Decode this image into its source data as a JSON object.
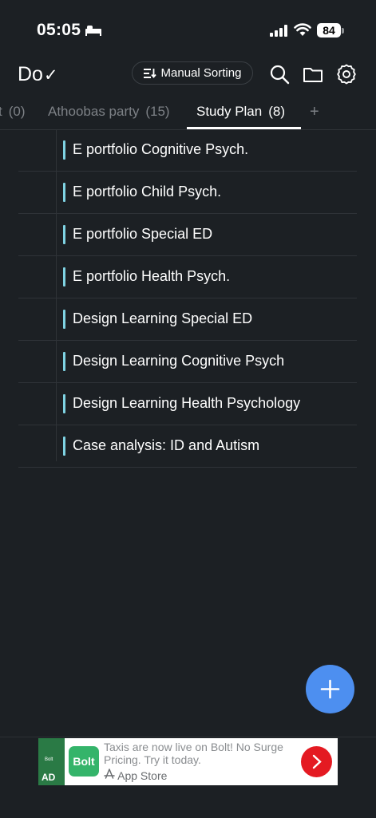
{
  "status_bar": {
    "time": "05:05",
    "battery": "84"
  },
  "header": {
    "title": "Do",
    "check_glyph": "✓",
    "sort_label": "Manual Sorting"
  },
  "tabs": [
    {
      "label": "t",
      "count": "(0)"
    },
    {
      "label": "Athoobas party",
      "count": "(15)"
    },
    {
      "label": "Study Plan",
      "count": "(8)",
      "active": true
    }
  ],
  "tab_add": "+",
  "tasks": [
    "E portfolio Cognitive Psych.",
    "E portfolio Child Psych.",
    "E portfolio Special ED",
    "E portfolio Health Psych.",
    "Design Learning Special ED",
    "Design Learning Cognitive Psych",
    "Design Learning Health Psychology",
    "Case analysis: ID and Autism"
  ],
  "ad": {
    "badge": "AD",
    "brand": "Bolt",
    "strip_text": "Bolt",
    "text": "Taxis are now live on Bolt! No Surge Pricing. Try it today.",
    "store": "App Store"
  },
  "colors": {
    "accent": "#7fd3e3",
    "fab": "#4d8ff0",
    "background": "#1c2024"
  }
}
